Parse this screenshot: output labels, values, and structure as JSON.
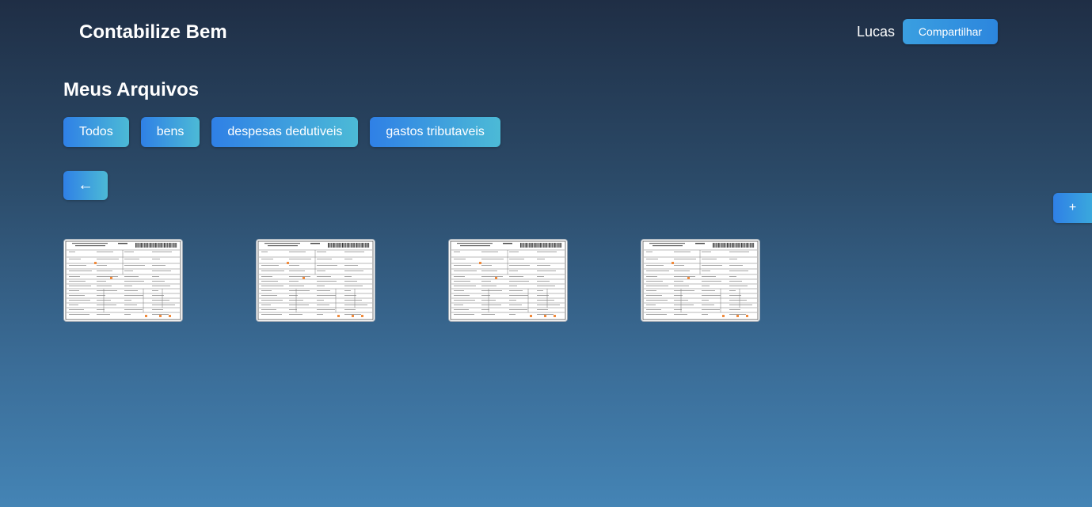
{
  "header": {
    "brand": "Contabilize Bem",
    "user_name": "Lucas",
    "share_label": "Compartilhar"
  },
  "main": {
    "title": "Meus Arquivos",
    "filters": [
      "Todos",
      "bens",
      "despesas dedutiveis",
      "gastos tributaveis"
    ],
    "back_label": "←",
    "add_label": "+",
    "files": [
      {
        "name": "file-thumbnail-1",
        "icon": "document-thumbnail"
      },
      {
        "name": "file-thumbnail-2",
        "icon": "document-thumbnail"
      },
      {
        "name": "file-thumbnail-3",
        "icon": "document-thumbnail"
      },
      {
        "name": "file-thumbnail-4",
        "icon": "document-thumbnail"
      }
    ]
  },
  "colors": {
    "bg_top": "#1f2e45",
    "bg_bottom": "#4484b5",
    "button_start": "#2f80e6",
    "button_end": "#4cbad6"
  }
}
